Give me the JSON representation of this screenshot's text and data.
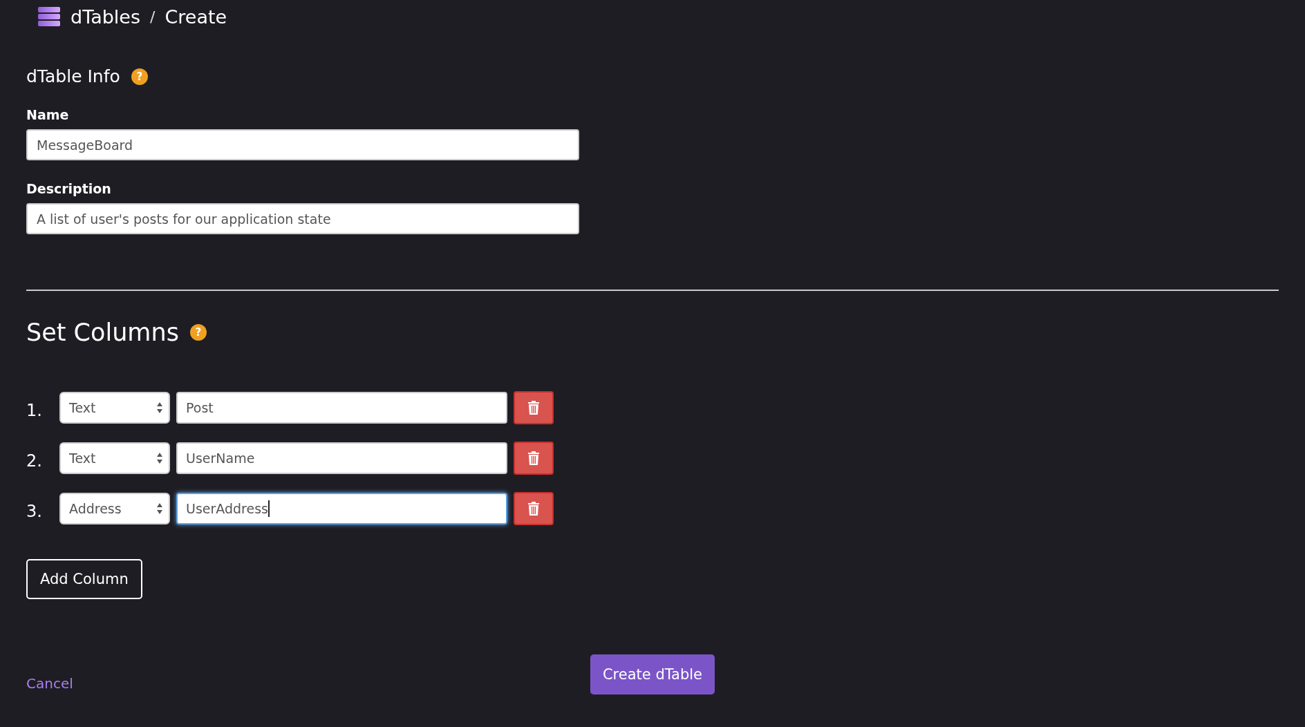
{
  "breadcrumb": {
    "app": "dTables",
    "separator": "/",
    "page": "Create"
  },
  "info": {
    "title": "dTable Info",
    "help": "?",
    "fields": [
      {
        "label": "Name",
        "value": "MessageBoard"
      },
      {
        "label": "Description",
        "value": "A list of user's posts for our application state"
      }
    ]
  },
  "columns_section": {
    "title": "Set Columns",
    "help": "?",
    "columns": [
      {
        "number": "1.",
        "type": "Text",
        "name": "Post",
        "focused": false
      },
      {
        "number": "2.",
        "type": "Text",
        "name": "UserName",
        "focused": false
      },
      {
        "number": "3.",
        "type": "Address",
        "name": "UserAddress",
        "focused": true
      }
    ],
    "add_button": "Add Column"
  },
  "footer": {
    "cancel": "Cancel",
    "submit": "Create dTable"
  }
}
